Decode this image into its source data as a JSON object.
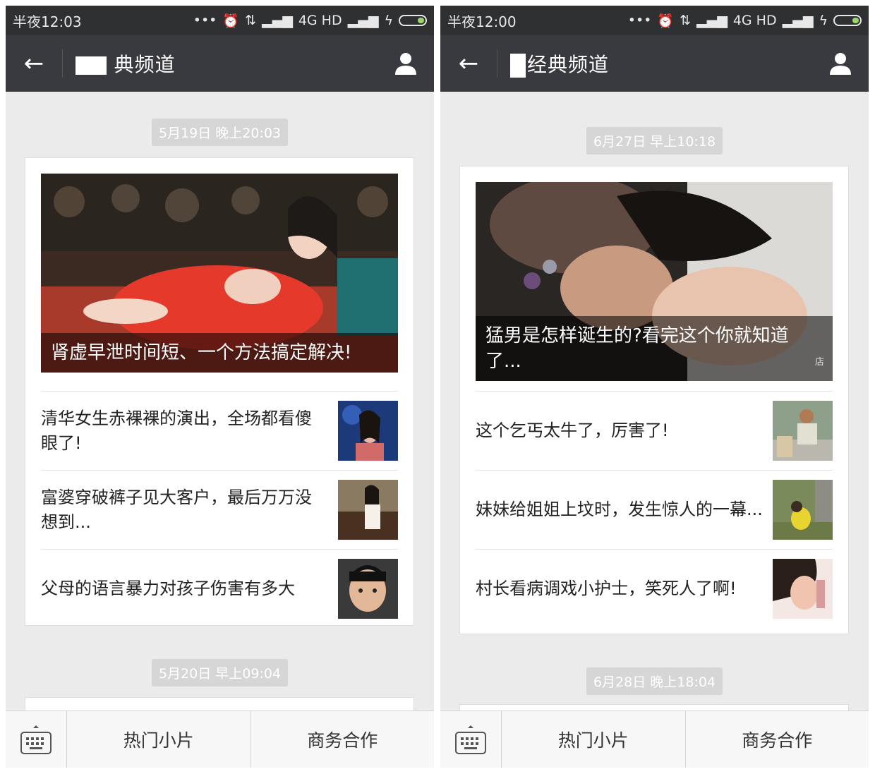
{
  "left": {
    "status_time": "半夜12:03",
    "status_network": "4G HD",
    "nav_title": " 典频道",
    "timestamp_1": "5月19日 晚上20:03",
    "cover_caption": "肾虚早泄时间短、一个方法搞定解决!",
    "items": [
      {
        "title": "清华女生赤裸裸的演出，全场都看傻眼了!"
      },
      {
        "title": "富婆穿破裤子见大客户，最后万万没想到..."
      },
      {
        "title": "父母的语言暴力对孩子伤害有多大"
      }
    ],
    "timestamp_2": "5月20日 早上09:04",
    "menu_1": "热门小片",
    "menu_2": "商务合作"
  },
  "right": {
    "status_time": "半夜12:00",
    "status_network": "4G HD",
    "nav_title": "经典频道",
    "timestamp_1": "6月27日 早上10:18",
    "cover_caption": "猛男是怎样诞生的?看完这个你就知道了...",
    "watermark": "店",
    "items": [
      {
        "title": "这个乞丐太牛了，厉害了!"
      },
      {
        "title": "妹妹给姐姐上坟时，发生惊人的一幕..."
      },
      {
        "title": "村长看病调戏小护士，笑死人了啊!"
      }
    ],
    "timestamp_2": "6月28日 晚上18:04",
    "menu_1": "热门小片",
    "menu_2": "商务合作"
  }
}
